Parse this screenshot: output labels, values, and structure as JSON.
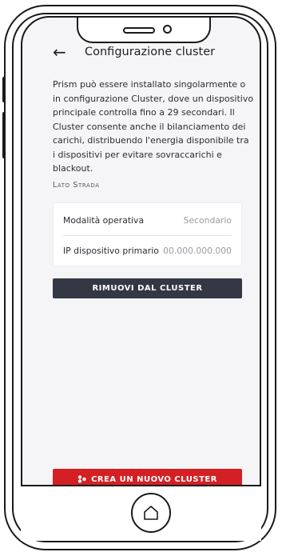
{
  "header": {
    "back_icon": "arrow-left-icon",
    "title": "Configurazione cluster"
  },
  "description": "Prism può essere installato singolarmente o in configurazione Cluster, dove un dispositivo principale controlla fino a 29 secondari. Il Cluster consente anche il bilanciamento dei carichi, distribuendo l'energia disponibile tra i dispositivi per evitare sovraccarichi e blackout.",
  "section": {
    "label": "Lato Strada",
    "rows": [
      {
        "key": "Modalità operativa",
        "value": "Secondario"
      },
      {
        "key": "IP dispositivo primario",
        "value": "00.000.000.000"
      }
    ]
  },
  "buttons": {
    "remove": "RIMUOVI DAL CLUSTER",
    "create": "CREA UN NUOVO CLUSTER",
    "create_icon": "cluster-icon"
  },
  "colors": {
    "remove_button": "#343845",
    "create_button": "#d42024",
    "background": "#f5f5f7"
  }
}
